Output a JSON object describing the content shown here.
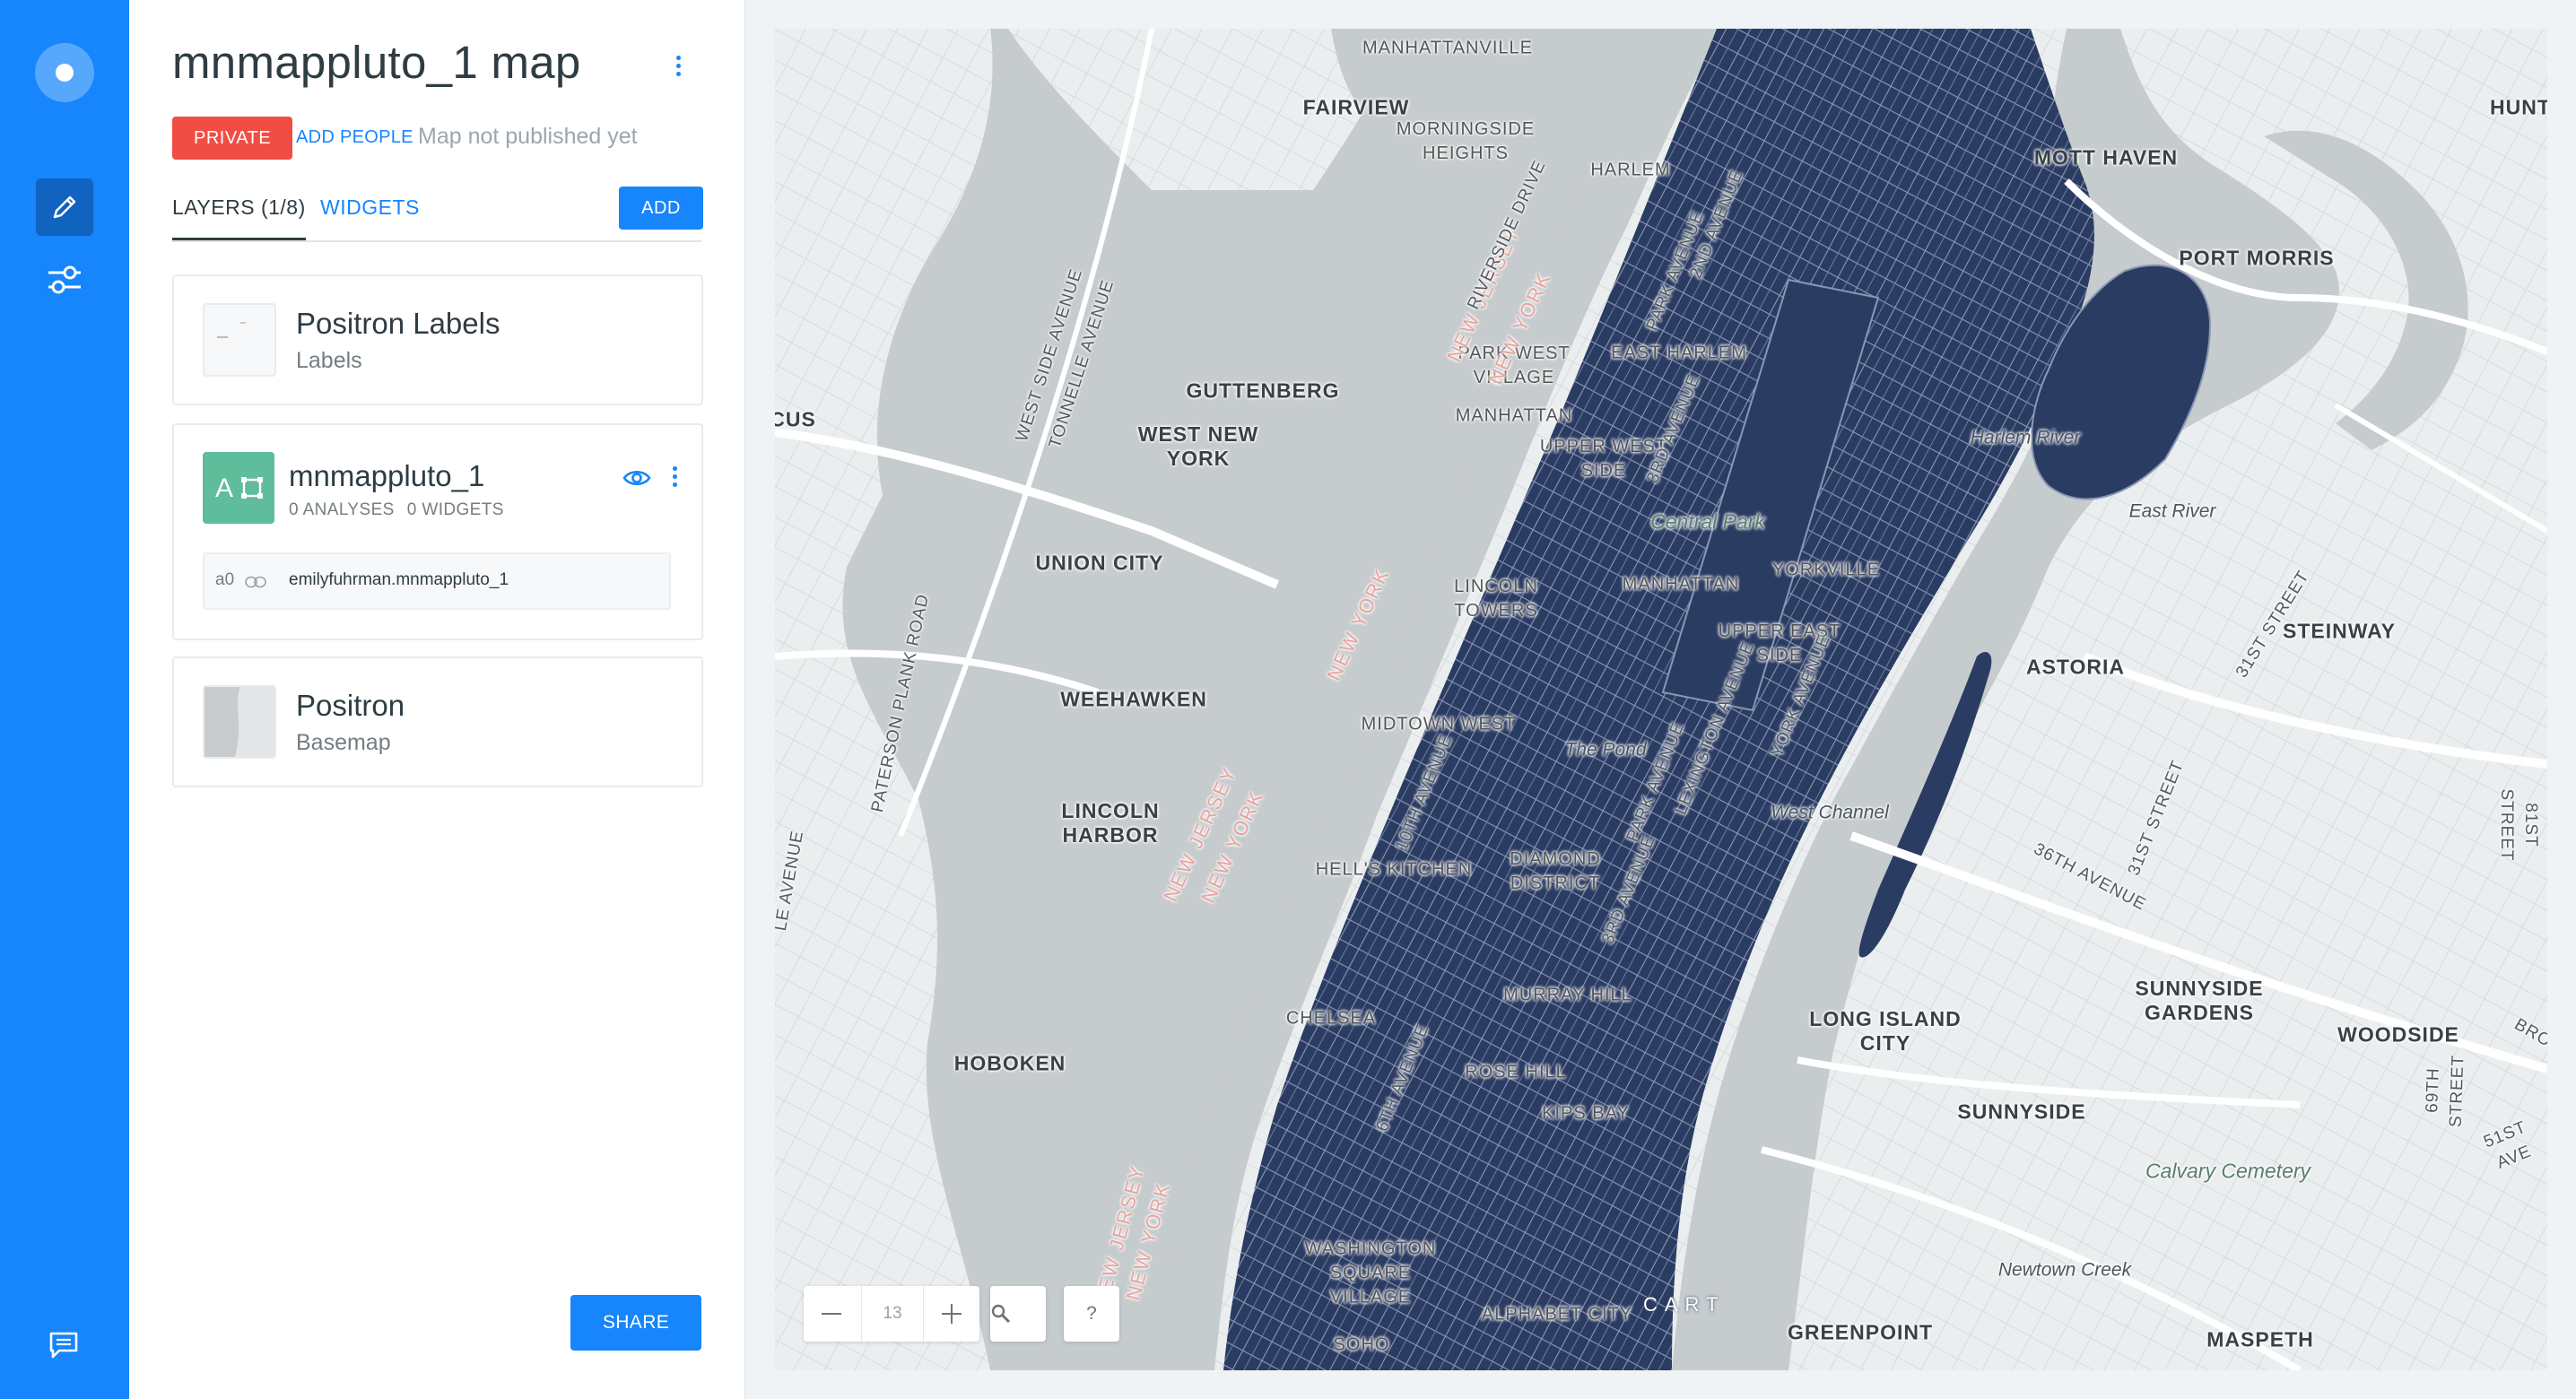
{
  "editor": {
    "map_title": "mnmappluto_1 map",
    "privacy": "PRIVATE",
    "add_people": "ADD PEOPLE",
    "publish_status": "Map not published yet",
    "tabs": [
      {
        "label": "LAYERS (1/8)",
        "active": true
      },
      {
        "label": "WIDGETS",
        "active": false
      }
    ],
    "add_button": "ADD",
    "layers": [
      {
        "name": "Positron Labels",
        "subtitle": "Labels"
      },
      {
        "letter": "A",
        "name": "mnmappluto_1",
        "analyses": "0 ANALYSES",
        "widgets": "0 WIDGETS",
        "source": {
          "node": "a0",
          "name": "emilyfuhrman.mnmappluto_1"
        }
      },
      {
        "name": "Positron",
        "subtitle": "Basemap"
      }
    ],
    "share_button": "SHARE"
  },
  "rail": {
    "icons": [
      "logo-icon",
      "pencil-icon",
      "sliders-icon",
      "feedback-icon"
    ]
  },
  "map": {
    "zoom_level": "13",
    "search_icon": "magnifier-icon",
    "help_label": "?",
    "attribution": "CART",
    "colors": {
      "land": "#ebeeef",
      "water": "#c6cbce",
      "layer_fill": "#2b3c63",
      "layer_stroke": "#8b97b3"
    },
    "labels": {
      "manhattanville": "MANHATTANVILLE",
      "fairview": "FAIRVIEW",
      "morningside": "MORNINGSIDE\nHEIGHTS",
      "harlem": "HARLEM",
      "mott_haven": "MOTT HAVEN",
      "hunt": "HUNT",
      "port_morris": "PORT MORRIS",
      "guttenberg": "GUTTENBERG",
      "west_new_york": "WEST NEW\nYORK",
      "park_west": "PARK WEST\nVILLAGE",
      "east_harlem": "EAST HARLEM",
      "manhattan_1": "MANHATTAN",
      "harlem_river": "Harlem River",
      "east_river": "East River",
      "upper_west": "UPPER WEST\nSIDE",
      "central_park": "Central Park",
      "cus": "CUS",
      "union_city": "UNION CITY",
      "lincoln_towers": "LINCOLN\nTOWERS",
      "manhattan_2": "MANHATTAN",
      "yorkville": "YORKVILLE",
      "upper_east": "UPPER EAST\nSIDE",
      "steinway": "STEINWAY",
      "astoria": "ASTORIA",
      "weehawken": "WEEHAWKEN",
      "midtown_west": "MIDTOWN WEST",
      "the_pond": "The Pond",
      "west_channel": "West Channel",
      "lincoln_harbor": "LINCOLN\nHARBOR",
      "hells_kitchen": "HELL'S KITCHEN",
      "diamond": "DIAMOND\nDISTRICT",
      "murray_hill": "MURRAY HILL",
      "long_island_city": "LONG ISLAND\nCITY",
      "sunnyside_gardens": "SUNNYSIDE\nGARDENS",
      "woodside": "WOODSIDE",
      "chelsea": "CHELSEA",
      "hoboken": "HOBOKEN",
      "rose_hill": "ROSE HILL",
      "kips_bay": "KIPS BAY",
      "sunnyside": "SUNNYSIDE",
      "calvary": "Calvary Cemetery",
      "newtown_creek": "Newtown Creek",
      "washington_sq": "WASHINGTON\nSQUARE\nVILLAGE",
      "alphabet_city": "ALPHABET CITY",
      "greenpoint": "GREENPOINT",
      "soho": "SOHO",
      "maspeth": "MASPETH",
      "nj_1": "NEW JERSEY",
      "ny_1": "NEW YORK",
      "ny_2": "NEW YORK",
      "nj_2": "NEW JERSEY",
      "ny_3": "NEW YORK",
      "nj_3": "NEW JERSEY",
      "ny_4": "NEW YORK",
      "west_side_ave": "WEST SIDE AVENUE",
      "tonnelle_ave": "TONNELLE AVENUE",
      "paterson_plank": "PATERSON PLANK ROAD",
      "le_avenue": "LE AVENUE",
      "riverside_drive": "RIVERSIDE DRIVE",
      "third_ave": "3RD AVENUE",
      "park_ave_n": "PARK AVENUE",
      "second_ave": "2ND AVENUE",
      "tenth_ave": "10TH AVENUE",
      "sixth_ave": "6TH AVENUE",
      "park_ave_s": "PARK AVENUE",
      "york_ave": "YORK AVENUE",
      "lexington_ave": "LEXINGTON AVENUE",
      "third_ave_s": "3RD AVENUE",
      "thirtyfirst_st_n": "31ST STREET",
      "thirtyfirst_st_s": "31ST STREET",
      "thirtysixth_ave": "36TH AVENUE",
      "eightyfirst_st": "81ST STREET",
      "sixtyninth_st": "69TH STREET",
      "fiftyfirst_ave": "51ST AVE",
      "bro": "BRO"
    }
  }
}
